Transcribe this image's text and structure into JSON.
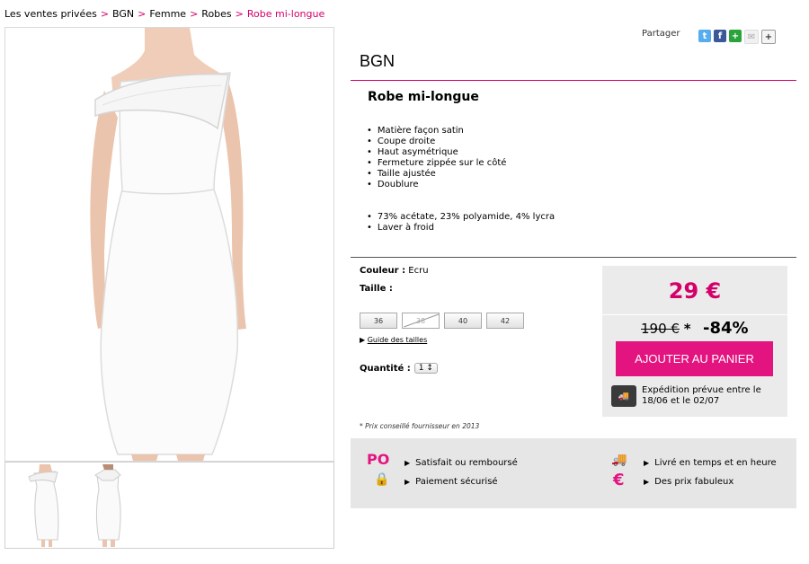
{
  "breadcrumb": {
    "items": [
      "Les ventes privées",
      "BGN",
      "Femme",
      "Robes"
    ],
    "current": "Robe mi-longue",
    "separator": ">"
  },
  "share": {
    "label": "Partager"
  },
  "product": {
    "brand": "BGN",
    "title": "Robe mi-longue",
    "features_a": [
      "Matière façon satin",
      "Coupe droite",
      "Haut asymétrique",
      "Fermeture zippée sur le côté",
      "Taille ajustée",
      "Doublure"
    ],
    "features_b": [
      "73% acétate, 23% polyamide, 4% lycra",
      "Laver à froid"
    ],
    "color_label": "Couleur :",
    "color_value": "Ecru",
    "size_label": "Taille :",
    "sizes": [
      "36",
      "38",
      "40",
      "42"
    ],
    "size_guide": "Guide des tailles",
    "qty_label": "Quantité :",
    "qty_value": "1",
    "note": "* Prix conseillé fournisseur en 2013"
  },
  "pricing": {
    "price": "29 €",
    "old_price": "190 €",
    "old_star": "*",
    "discount": "-84%",
    "cart_button": "AJOUTER AU PANIER",
    "shipping": "Expédition prévue entre le 18/06 et le 02/07"
  },
  "guarantees": {
    "satisfied": "Satisfait ou remboursé",
    "secure": "Paiement sécurisé",
    "delivery": "Livré en temps et en heure",
    "prices": "Des prix fabuleux",
    "logo_text": "PO",
    "euro": "€"
  },
  "colors": {
    "accent": "#d4006a",
    "button": "#e3147f"
  }
}
